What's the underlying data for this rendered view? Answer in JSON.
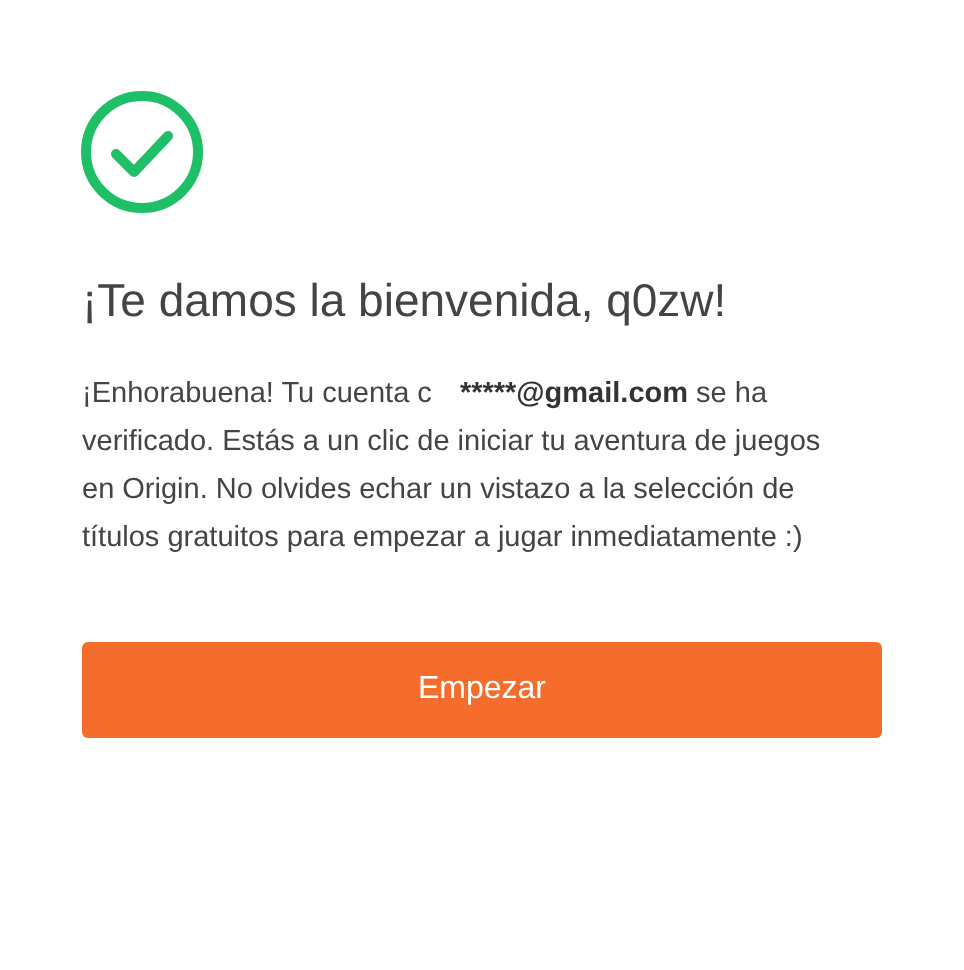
{
  "title": "¡Te damos la bienvenida, q0zw!",
  "message": {
    "before": "¡Enhorabuena! Tu cuenta c",
    "email": "*****@gmail.com",
    "after": " se ha verificado. Estás a un clic de iniciar tu aventura de juegos en Origin. No olvides echar un vistazo a la selección de títulos gratuitos para empezar a jugar inmediatamente :)"
  },
  "button": "Empezar"
}
